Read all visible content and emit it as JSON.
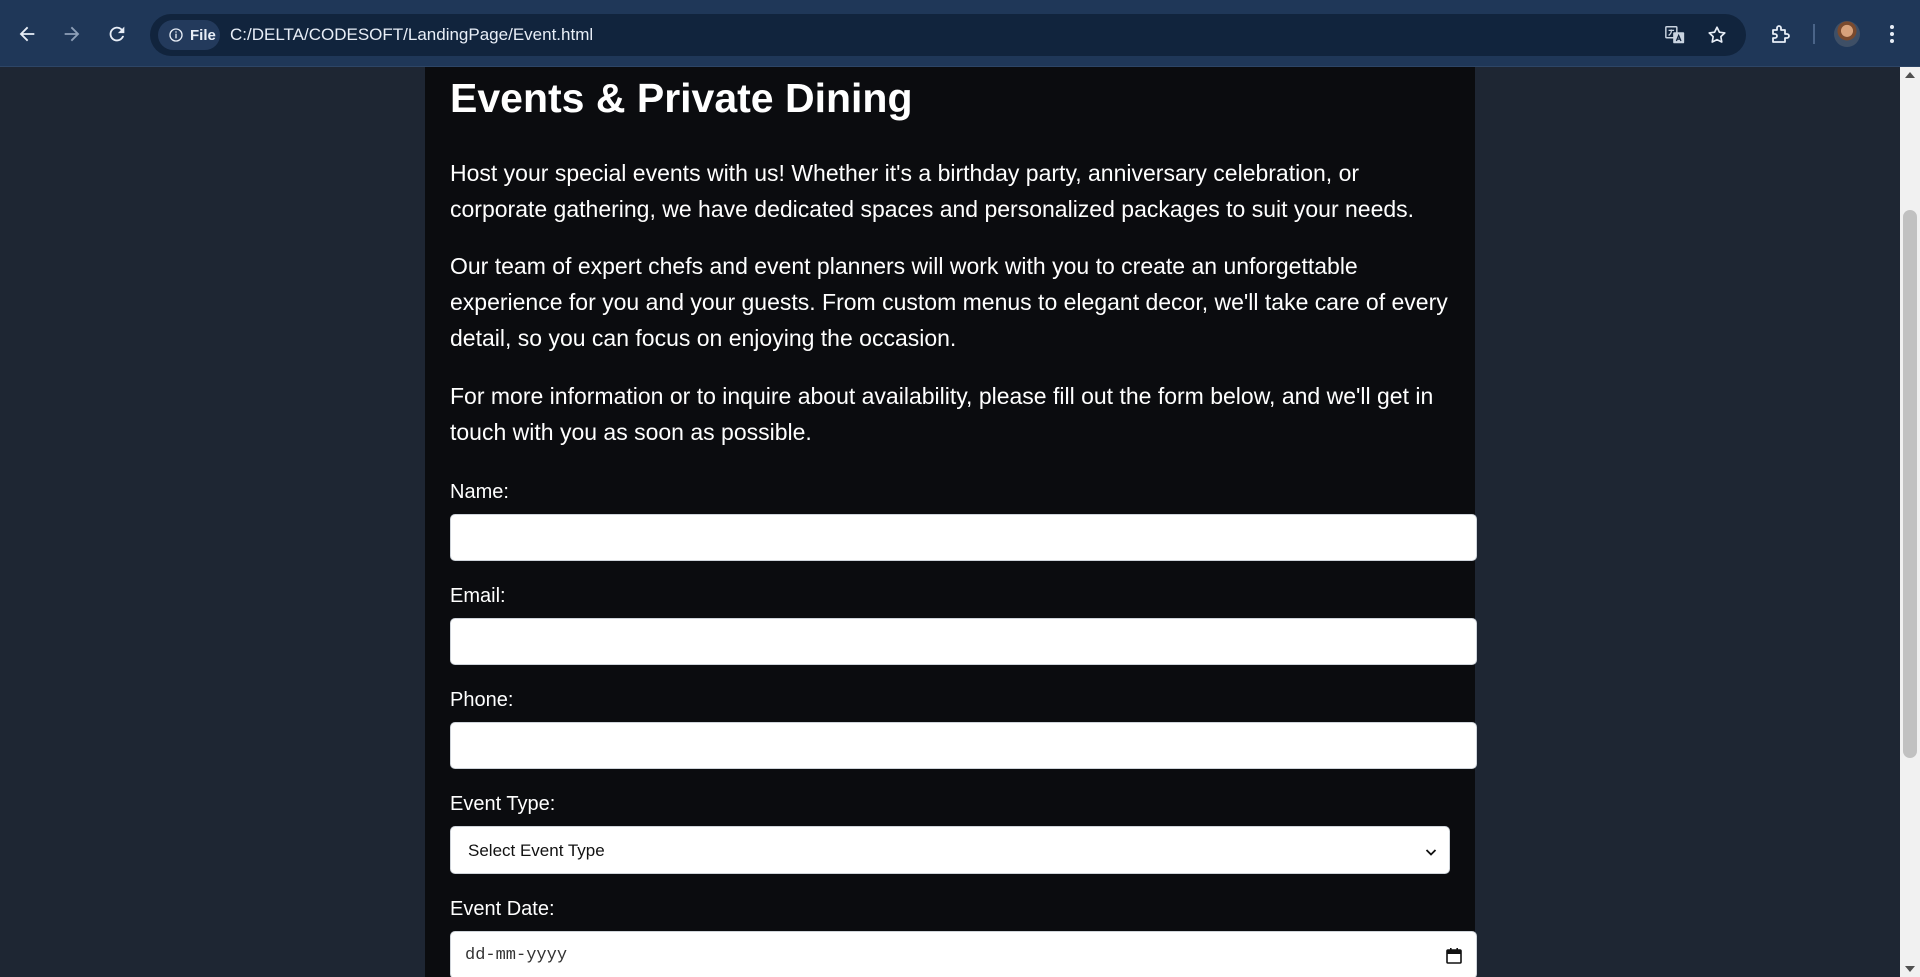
{
  "browser": {
    "site_chip_label": "File",
    "url": "C:/DELTA/CODESOFT/LandingPage/Event.html",
    "icons": {
      "back": "arrow-left-icon",
      "forward": "arrow-right-icon",
      "reload": "reload-icon",
      "site_info": "info-icon",
      "translate": "translate-icon",
      "bookmark": "star-icon",
      "extensions": "puzzle-icon",
      "profile": "avatar",
      "menu": "kebab-menu-icon"
    },
    "colors": {
      "toolbar": "#1f3758",
      "omnibox": "#11243d"
    }
  },
  "page": {
    "title": "Events & Private Dining",
    "paragraphs": [
      "Host your special events with us! Whether it's a birthday party, anniversary celebration, or corporate gathering, we have dedicated spaces and personalized packages to suit your needs.",
      "Our team of expert chefs and event planners will work with you to create an unforgettable experience for you and your guests. From custom menus to elegant decor, we'll take care of every detail, so you can focus on enjoying the occasion.",
      "For more information or to inquire about availability, please fill out the form below, and we'll get in touch with you as soon as possible."
    ],
    "colors": {
      "background": "#1e2633",
      "card": "#0b0c0f",
      "text": "#ffffff"
    }
  },
  "form": {
    "name_label": "Name:",
    "name_value": "",
    "email_label": "Email:",
    "email_value": "",
    "phone_label": "Phone:",
    "phone_value": "",
    "event_type_label": "Event Type:",
    "event_type_selected": "Select Event Type",
    "event_date_label": "Event Date:",
    "event_date_placeholder": "dd-mm-yyyy"
  }
}
